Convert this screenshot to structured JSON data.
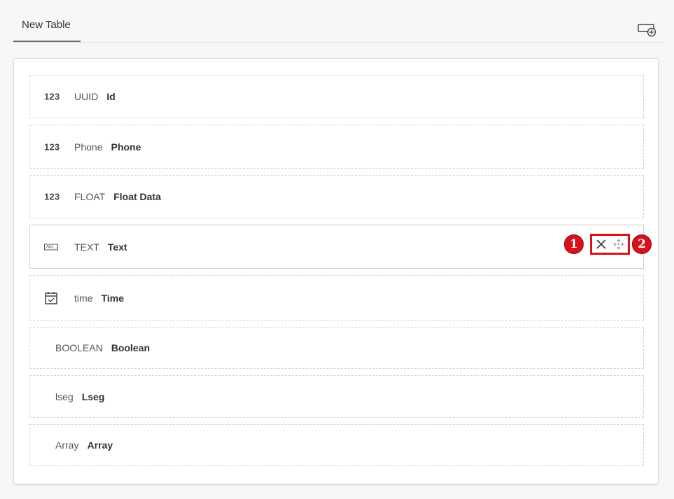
{
  "tabs": [
    {
      "label": "New Table"
    }
  ],
  "fields": [
    {
      "icon": "number-icon",
      "icon_text": "123",
      "type": "UUID",
      "name": "Id"
    },
    {
      "icon": "number-icon",
      "icon_text": "123",
      "type": "Phone",
      "name": "Phone"
    },
    {
      "icon": "number-icon",
      "icon_text": "123",
      "type": "FLOAT",
      "name": "Float Data"
    },
    {
      "icon": "text-icon",
      "icon_text": "Abc...",
      "type": "TEXT",
      "name": "Text"
    },
    {
      "icon": "calendar-icon",
      "type": "time",
      "name": "Time"
    },
    {
      "type": "BOOLEAN",
      "name": "Boolean"
    },
    {
      "type": "lseg",
      "name": "Lseg"
    },
    {
      "type": "Array",
      "name": "Array"
    }
  ],
  "callouts": [
    "1",
    "2"
  ],
  "colors": {
    "accent": "#d8111b",
    "tab_underline": "#6a6a6a"
  }
}
